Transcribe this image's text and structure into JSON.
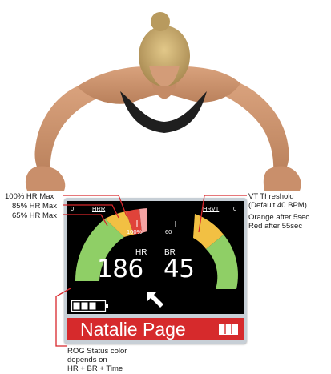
{
  "annotations": {
    "hr_max_100": "100% HR Max",
    "hr_max_85": "85% HR Max",
    "hr_max_65": "65% HR Max",
    "vt_threshold_1": "VT Threshold",
    "vt_threshold_2": "(Default 40 BPM)",
    "vt_orange": "Orange after 5sec",
    "vt_red": "Red after 55sec",
    "rog_1": "ROG Status color",
    "rog_2": "depends on",
    "rog_3": "HR + BR + Time"
  },
  "device": {
    "hr_gauge": {
      "zero": "0",
      "label": "HRR",
      "pct_label": "100%",
      "needle_fraction": 0.9
    },
    "br_gauge": {
      "zero": "0",
      "label": "HRVT",
      "tick_value": "60"
    },
    "hr_caption": "HR",
    "br_caption": "BR",
    "hr_value": "186",
    "br_value": "45",
    "battery_level": 0.75,
    "trend_icon": "arrow-up-left-icon",
    "name": "Natalie Page",
    "status_icon": "card-icon",
    "colors": {
      "green": "#8fcf66",
      "yellow": "#f2c043",
      "red": "#e0433a",
      "pink": "#f5a3a3",
      "status_bar": "#d62a2c"
    }
  }
}
